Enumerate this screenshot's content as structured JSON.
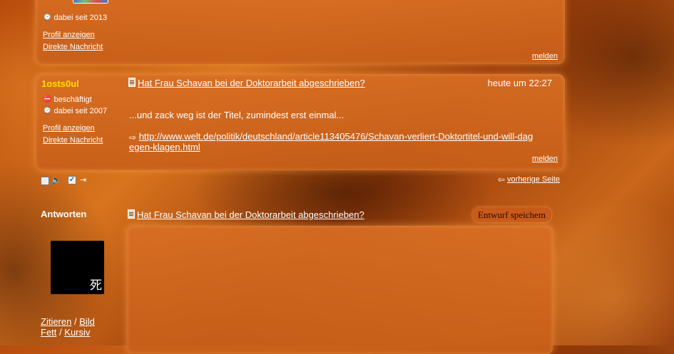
{
  "top_post": {
    "member_since": "dabei seit 2013",
    "profile_link": "Profil anzeigen",
    "message_link": "Direkte Nachricht",
    "report_link": "melden"
  },
  "post": {
    "username": "1osts0ul",
    "status": "beschäftigt",
    "member_since": "dabei seit 2007",
    "profile_link": "Profil anzeigen",
    "message_link": "Direkte Nachricht",
    "title": "Hat Frau Schavan bei der Doktorarbeit abgeschrieben?",
    "time": "heute um 22:27",
    "body": "...und zack weg ist der Titel, zumindest erst einmal...",
    "url": "http://www.welt.de/politik/deutschland/article113405476/Schavan-verliert-Doktortitel-und-will-dagegen-klagen.html",
    "report_link": "melden"
  },
  "toolbar": {
    "prev_page": "vorherige Seite"
  },
  "reply": {
    "heading": "Antworten",
    "title": "Hat Frau Schavan bei der Doktorarbeit abgeschrieben?",
    "save_draft": "Entwurf speichem",
    "avatar_glyph": "死",
    "cite": "Zitieren",
    "image": "Bild",
    "bold": "Fett",
    "italic": "Kursiv",
    "separator": "/"
  }
}
